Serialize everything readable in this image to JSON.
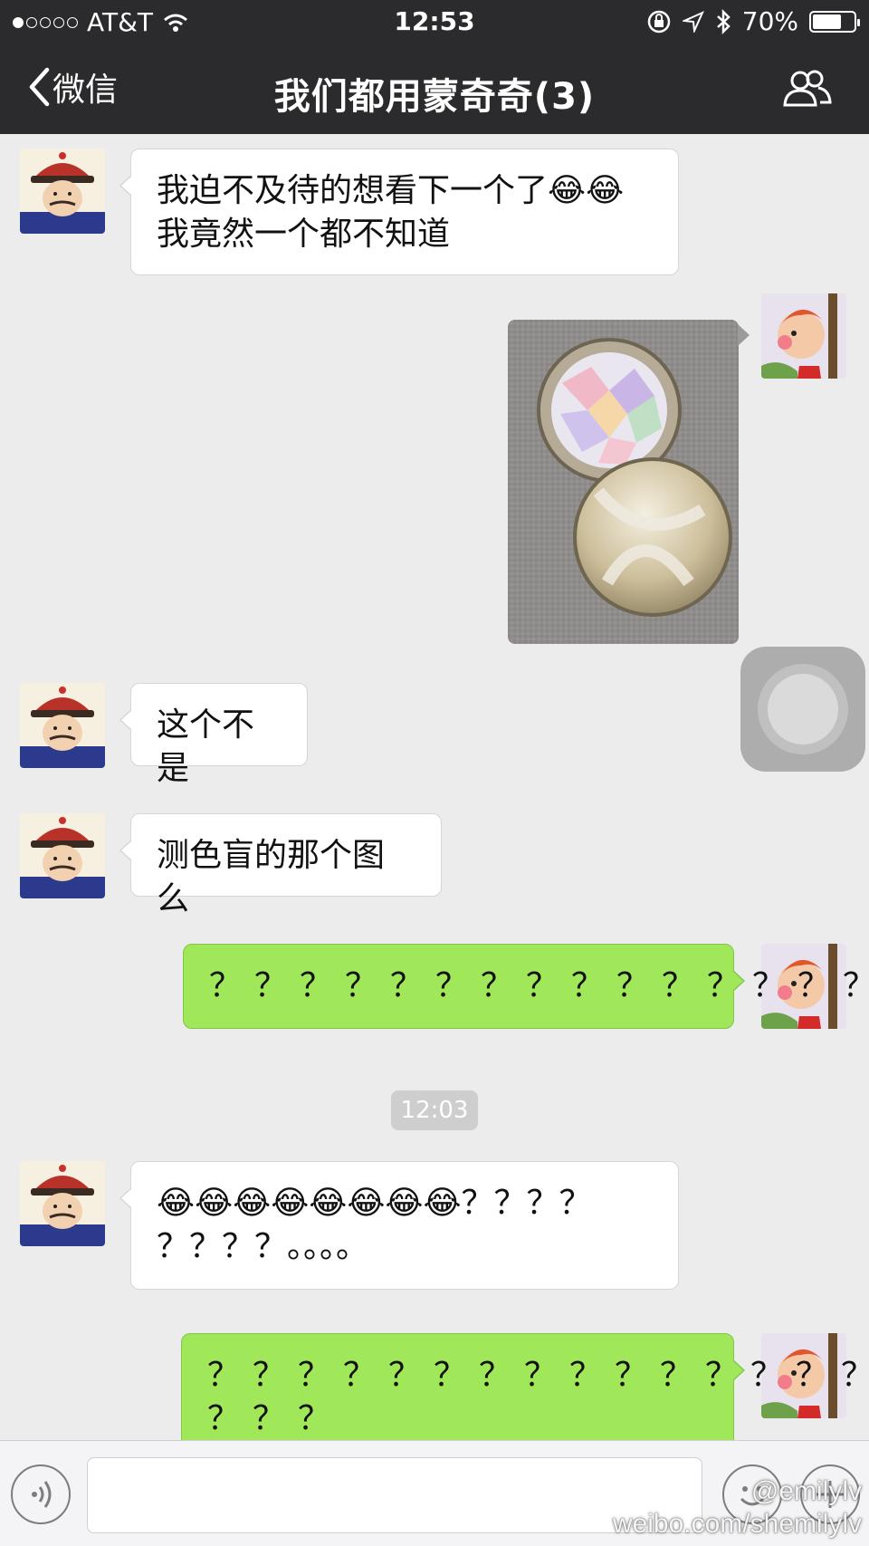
{
  "status_bar": {
    "carrier": "AT&T",
    "time": "12:53",
    "battery": "70%",
    "battery_level": 0.7
  },
  "nav": {
    "back_label": "微信",
    "title": "我们都用蒙奇奇(3)",
    "group_icon": "group-members-icon"
  },
  "messages": [
    {
      "side": "left",
      "type": "text",
      "text": "我迫不及待的想看下一个了😂😂\n我竟然一个都不知道"
    },
    {
      "side": "right",
      "type": "image",
      "description": "photo"
    },
    {
      "side": "left",
      "type": "text",
      "text": "这个不是"
    },
    {
      "side": "left",
      "type": "text",
      "text": "测色盲的那个图么"
    },
    {
      "side": "right",
      "type": "text",
      "text": "？？？？？？？？？？？？？？？"
    },
    {
      "side": "left",
      "type": "text",
      "text": "😂😂😂😂😂😂😂😂？？？？\n？？？？。。。。"
    },
    {
      "side": "right",
      "type": "text",
      "text": "？？？？？？？？？？？？？？？\n？？？"
    }
  ],
  "timestamp": "12:03",
  "input_bar": {
    "placeholder": "",
    "voice_icon": "voice-icon",
    "emoji_icon": "emoji-icon",
    "plus_icon": "plus-icon"
  },
  "watermark": {
    "line1": "@emilylv",
    "line2": "weibo.com/shemilylv"
  },
  "colors": {
    "nav_bg": "#2b2b2d",
    "chat_bg": "#ececec",
    "sent_bubble": "#a0e75a",
    "received_bubble": "#ffffff"
  }
}
